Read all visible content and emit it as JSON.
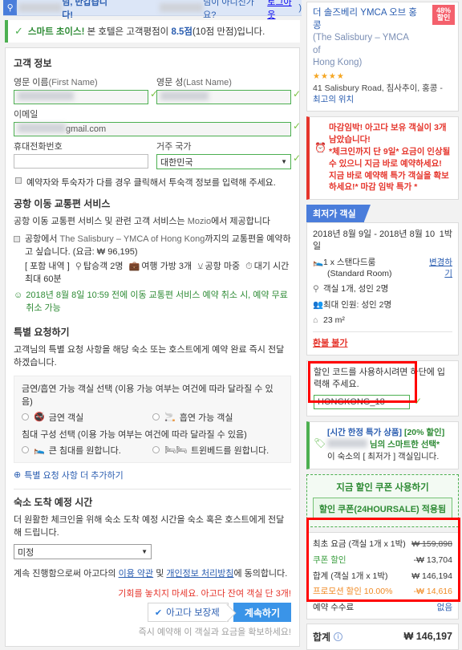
{
  "header": {
    "greeting_suffix": "님, 반갑습니다!",
    "not_you": "님이 아니신가요?",
    "logout": "로그아웃",
    "paren_open": "(",
    "paren_close": ")"
  },
  "smart_choice": {
    "check_icon": "check-icon",
    "label": "스마트 초이스!",
    "text_before": "본 호텔은 고객평점이",
    "score": "8.5점",
    "text_after": "(10점 만점)입니다."
  },
  "guest_info": {
    "title": "고객 정보",
    "first_name_label": "영문 이름",
    "first_name_label_en": "(First Name)",
    "last_name_label": "영문 성",
    "last_name_label_en": "(Last Name)",
    "email_label": "이메일",
    "email_value_visible": "gmail.com",
    "phone_label": "휴대전화번호",
    "phone_value": "",
    "country_label": "거주 국가",
    "country_value": "대한민국",
    "different_guest_note": "예약자와 투숙자가 다를 경우 클릭해서 투숙객 정보를 입력해 주세요."
  },
  "airport_transfer": {
    "title": "공항 이동 교통편 서비스",
    "provider_line_1": "공항 이동 교통편 서비스 및 관련 고객 서비스는",
    "provider_name": "Mozio",
    "provider_line_2": "에서 제공합니다",
    "checkbox_text_1": "공항에서",
    "checkbox_hotel": "The Salisbury – YMCA of Hong Kong",
    "checkbox_text_2": "까지의 교통편을 예약하고 싶습니다.",
    "fare_label": "(요금: ₩ 96,195)",
    "inclusions_label": "[ 포함 내역 ]",
    "inclusions": [
      {
        "icon": "person-icon",
        "text": "탑승객 2명"
      },
      {
        "icon": "luggage-icon",
        "text": "여행 가방 3개"
      },
      {
        "icon": "meet-greet-icon",
        "text": "공항 마중"
      },
      {
        "icon": "clock-icon",
        "text": "대기 시간 최대 60분"
      }
    ],
    "cancel_icon": "smile-check-icon",
    "cancel_text": "2018년 8월 8일 10:59 전에 이동 교통편 서비스 예약 취소 시, 예약 무료 취소 가능"
  },
  "special_request": {
    "title": "특별 요청하기",
    "description": "고객님의 특별 요청 사항을 해당 숙소 또는 호스트에게 예약 완료 즉시 전달하겠습니다.",
    "smoking_title": "금연/흡연 가능 객실 선택 (이용 가능 여부는 여건에 따라 달라질 수 있음)",
    "smoking_options": [
      {
        "icon": "no-smoking-icon",
        "label": "금연 객실"
      },
      {
        "icon": "smoking-icon",
        "label": "흡연 가능 객실"
      }
    ],
    "bed_title": "침대 구성 선택 (이용 가능 여부는 여건에 따라 달라질 수 있음)",
    "bed_options": [
      {
        "icon": "double-bed-icon",
        "label": "큰 침대를 원합니다."
      },
      {
        "icon": "twin-bed-icon",
        "label": "트윈베드를 원합니다."
      }
    ],
    "add_more": "특별 요청 사항 더 추가하기",
    "add_more_icon": "plus-circle-icon"
  },
  "arrival": {
    "title": "숙소 도착 예정 시간",
    "description": "더 원활한 체크인을 위해 숙소 도착 예정 시간을 숙소 혹은 호스트에게 전달해 드립니다.",
    "select_value": "미정"
  },
  "footer": {
    "agree_1": "계속 진행함으로써 아고다의",
    "terms": "이용 약관",
    "agree_mid": "및",
    "privacy": "개인정보 처리방침",
    "agree_2": "에 동의합니다.",
    "urgency": "기회를 놓치지 마세요. 아고다 잔여 객실 단 3개!",
    "guarantee_icon": "shield-check-icon",
    "guarantee_label": "아고다 보장제",
    "continue_label": "계속하기",
    "after_note": "즉시 예약해 이 객실과 요금을 확보하세요!"
  },
  "sidebar": {
    "hotel": {
      "name_ko": "더 솔즈베리 YMCA 오브 홍콩",
      "name_en_1": "(The Salisbury – YMCA of",
      "name_en_2": "Hong Kong)",
      "badge_pct": "48%",
      "badge_label": "할인",
      "stars": "★★★★",
      "address": "41 Salisbury Road, 침사추이, 홍콩 -",
      "address_link": "최고의 위치"
    },
    "alert": {
      "icon": "alarm-clock-icon",
      "line1": "마감임박! 아고다 보유 객실이 3개 남았습니다!",
      "line2": "*체크인까지 단 9일* 요금이 인상될 수 있으니 지금 바로 예약하세요!",
      "line3": "지금 바로 예약해 특가 객실을 확보하세요!* 마감 임박 특가 *"
    },
    "room": {
      "tab_label": "최저가 객실",
      "dates": "2018년 8월 9일 - 2018년 8월 10일",
      "nights": "1박",
      "room_icon": "bed-icon",
      "room_name": "1 x 스탠다드룸",
      "room_name_en": "(Standard Room)",
      "change_link": "변경하기",
      "occupancy_icon": "person-icon",
      "occupancy": "객실 1개, 성인 2명",
      "max_icon": "people-icon",
      "max_occupancy": "최대 인원: 성인 2명",
      "size_icon": "area-icon",
      "size": "23 m²",
      "refund": "환불 불가"
    },
    "promo": {
      "hint": "할인 코드를 사용하시려면 하단에 입력해 주세요.",
      "label": "할인 코드",
      "value": "HONGKONG_18",
      "valid_icon": "check-icon"
    },
    "smart_pick": {
      "tag_icon": "tag-icon",
      "line1_a": "[시간 한정 특가 상품]",
      "line1_b": "[20% 할인]",
      "line2": "님의 스마트한 선택*",
      "line3": "이 숙소의 [ 최저가 ] 객실입니다."
    },
    "coupon": {
      "title": "지금 할인 쿠폰 사용하기",
      "applied_label": "할인 쿠폰(24HOURSALE) 적용됨"
    },
    "price": {
      "rows": [
        {
          "label": "최초 요금 (객실 1개 x 1박)",
          "value": "₩ 159,898",
          "style": "strike"
        },
        {
          "label": "쿠폰 할인",
          "value": "-₩ 13,704",
          "style": "green"
        },
        {
          "label": "합계 (객실 1개 x 1박)",
          "value": "₩ 146,194",
          "style": "plain"
        },
        {
          "label": "프로모션 할인 10.00%",
          "value": "-₩ 14,616",
          "style": "orange"
        },
        {
          "label": "예약 수수료",
          "value": "없음",
          "style": "blue"
        }
      ],
      "total_label": "합계",
      "total_info_icon": "info-icon",
      "total_value": "₩ 146,197"
    }
  },
  "annotations": {
    "boxes": [
      {
        "name": "promo-code-highlight"
      },
      {
        "name": "price-breakdown-highlight"
      }
    ],
    "color": "#ff0000"
  }
}
